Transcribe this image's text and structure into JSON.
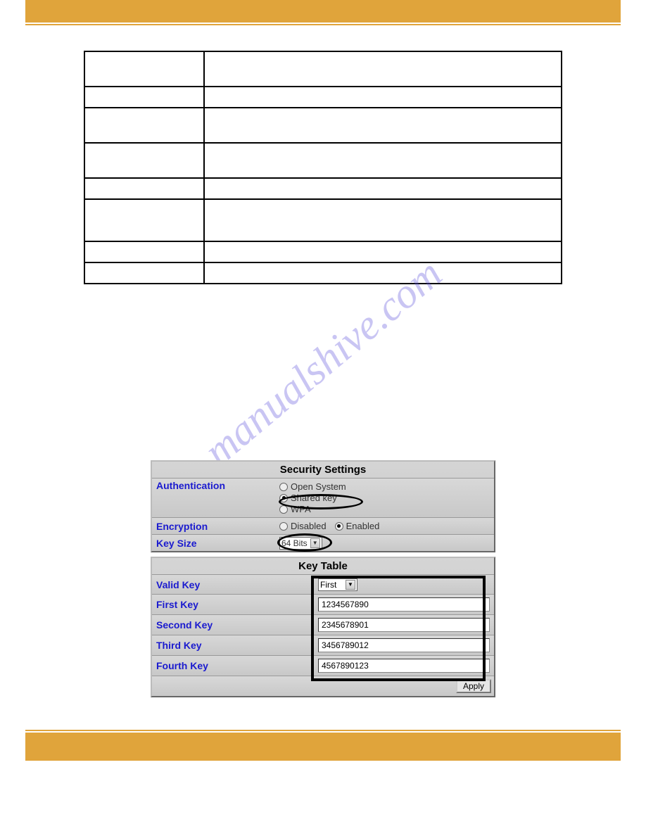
{
  "watermark": "manualshive.com",
  "security_panel": {
    "title": "Security Settings",
    "auth_label": "Authentication",
    "auth_options": {
      "open": "Open System",
      "shared": "Shared key",
      "wpa": "WPA"
    },
    "auth_selected": "shared",
    "enc_label": "Encryption",
    "enc_options": {
      "disabled": "Disabled",
      "enabled": "Enabled"
    },
    "enc_selected": "enabled",
    "keysize_label": "Key Size",
    "keysize_value": "64 Bits"
  },
  "key_table": {
    "title": "Key Table",
    "valid_label": "Valid Key",
    "valid_value": "First",
    "rows": {
      "first": {
        "label": "First Key",
        "value": "1234567890"
      },
      "second": {
        "label": "Second Key",
        "value": "2345678901"
      },
      "third": {
        "label": "Third Key",
        "value": "3456789012"
      },
      "fourth": {
        "label": "Fourth Key",
        "value": "4567890123"
      }
    },
    "apply": "Apply"
  }
}
